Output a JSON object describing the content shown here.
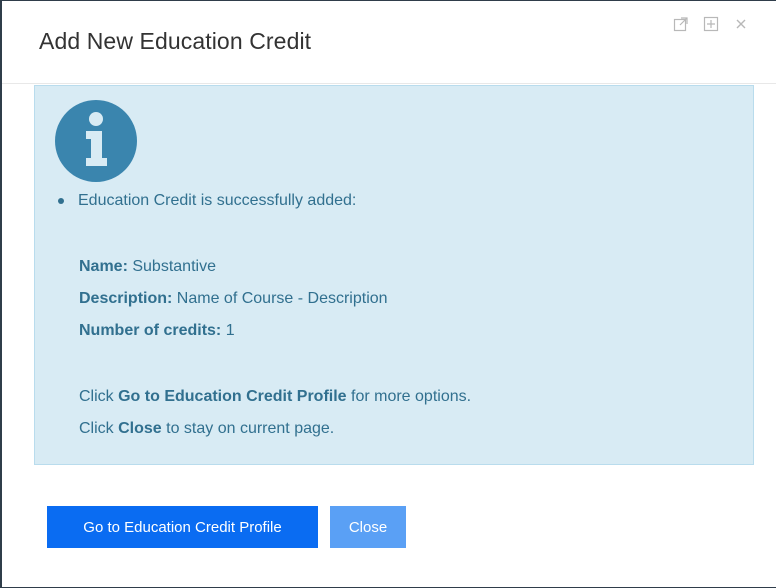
{
  "dialog": {
    "title": "Add New Education Credit",
    "header_icons": [
      "external-link-icon",
      "expand-icon",
      "close-icon"
    ]
  },
  "alert": {
    "icon": "info-icon",
    "message": "Education Credit is successfully added:",
    "fields": [
      {
        "label": "Name:",
        "value": "Substantive"
      },
      {
        "label": "Description:",
        "value": "Name of Course - Description"
      },
      {
        "label": "Number of credits:",
        "value": "1"
      }
    ],
    "hint1": {
      "prefix": "Click ",
      "bold": "Go to Education Credit Profile",
      "suffix": " for more options."
    },
    "hint2": {
      "prefix": "Click ",
      "bold": "Close",
      "suffix": " to stay on current page."
    }
  },
  "buttons": {
    "primary_label": "Go to Education Credit Profile",
    "close_label": "Close"
  },
  "colors": {
    "alert_bg": "#d8ebf4",
    "alert_text": "#31708f",
    "primary": "#0a6cf2",
    "secondary": "#5aa0f5"
  }
}
